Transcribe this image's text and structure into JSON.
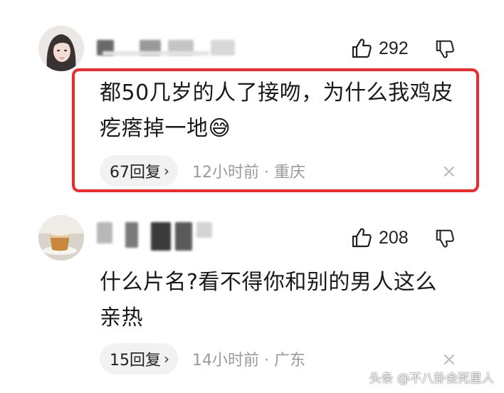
{
  "comments": [
    {
      "likes": "292",
      "text": "都50几岁的人了接吻，为什么我鸡皮疙瘩掉一地😅",
      "reply_label": "67回复",
      "reply_chevron": "›",
      "time_location": "12小时前 · 重庆",
      "close_glyph": "×"
    },
    {
      "likes": "208",
      "text": "什么片名?看不得你和别的男人这么亲热",
      "reply_label": "15回复",
      "reply_chevron": "›",
      "time_location": "14小时前 · 广东",
      "close_glyph": "×"
    }
  ],
  "watermark": "头条 @不八卦会死星人",
  "colors": {
    "highlight_border": "#ee2b2b",
    "pill_bg": "#f2f2f2",
    "meta_gray": "#9a9a9a"
  },
  "icons": {
    "like": "thumbs-up-icon",
    "dislike": "thumbs-down-icon",
    "close": "close-icon"
  }
}
